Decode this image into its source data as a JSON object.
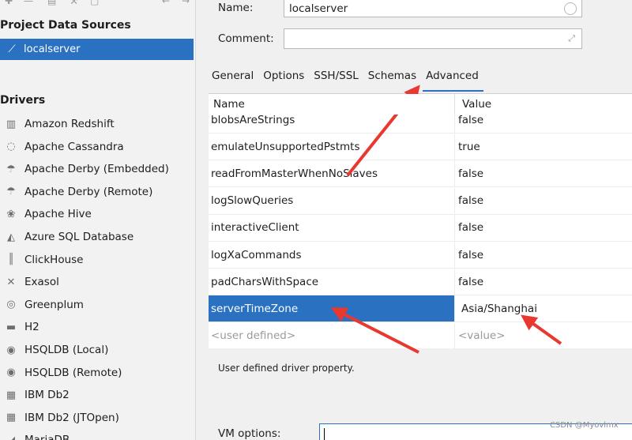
{
  "left": {
    "datasources_title": "Project Data Sources",
    "datasource": {
      "label": "localserver",
      "icon": "datasource-icon"
    },
    "drivers_title": "Drivers",
    "drivers": [
      {
        "label": "Amazon Redshift",
        "icon": "redshift-icon",
        "glyph": "▥"
      },
      {
        "label": "Apache Cassandra",
        "icon": "cassandra-icon",
        "glyph": "◌"
      },
      {
        "label": "Apache Derby (Embedded)",
        "icon": "derby-icon",
        "glyph": "☂"
      },
      {
        "label": "Apache Derby (Remote)",
        "icon": "derby-icon",
        "glyph": "☂"
      },
      {
        "label": "Apache Hive",
        "icon": "hive-icon",
        "glyph": "❀"
      },
      {
        "label": "Azure SQL Database",
        "icon": "azure-icon",
        "glyph": "◭"
      },
      {
        "label": "ClickHouse",
        "icon": "clickhouse-icon",
        "glyph": "║"
      },
      {
        "label": "Exasol",
        "icon": "exasol-icon",
        "glyph": "✕"
      },
      {
        "label": "Greenplum",
        "icon": "greenplum-icon",
        "glyph": "◎"
      },
      {
        "label": "H2",
        "icon": "h2-icon",
        "glyph": "▬"
      },
      {
        "label": "HSQLDB (Local)",
        "icon": "hsqldb-icon",
        "glyph": "◉"
      },
      {
        "label": "HSQLDB (Remote)",
        "icon": "hsqldb-icon",
        "glyph": "◉"
      },
      {
        "label": "IBM Db2",
        "icon": "ibm-db2-icon",
        "glyph": "▦"
      },
      {
        "label": "IBM Db2 (JTOpen)",
        "icon": "ibm-db2-icon",
        "glyph": "▦"
      },
      {
        "label": "MariaDB",
        "icon": "mariadb-icon",
        "glyph": "◢"
      }
    ]
  },
  "form": {
    "name_label": "Name:",
    "name_value": "localserver",
    "comment_label": "Comment:",
    "comment_value": ""
  },
  "tabs": [
    {
      "label": "General",
      "active": false
    },
    {
      "label": "Options",
      "active": false
    },
    {
      "label": "SSH/SSL",
      "active": false
    },
    {
      "label": "Schemas",
      "active": false
    },
    {
      "label": "Advanced",
      "active": true
    }
  ],
  "table": {
    "headers": {
      "name": "Name",
      "value": "Value"
    },
    "rows": [
      {
        "name": "blobsAreStrings",
        "value": "false"
      },
      {
        "name": "emulateUnsupportedPstmts",
        "value": "true"
      },
      {
        "name": "readFromMasterWhenNoSlaves",
        "value": "false"
      },
      {
        "name": "logSlowQueries",
        "value": "false"
      },
      {
        "name": "interactiveClient",
        "value": "false"
      },
      {
        "name": "logXaCommands",
        "value": "false"
      },
      {
        "name": "padCharsWithSpace",
        "value": "false"
      },
      {
        "name": "serverTimeZone",
        "value": "Asia/Shanghai",
        "selected": true
      },
      {
        "name": "<user defined>",
        "value": "<value>",
        "placeholder": true
      }
    ]
  },
  "description": "User defined driver property.",
  "vm_options_label": "VM options:",
  "vm_options_value": "",
  "watermark": "CSDN @Myovlmx",
  "colors": {
    "accent": "#2a71c2",
    "arrow": "#e8382f"
  }
}
